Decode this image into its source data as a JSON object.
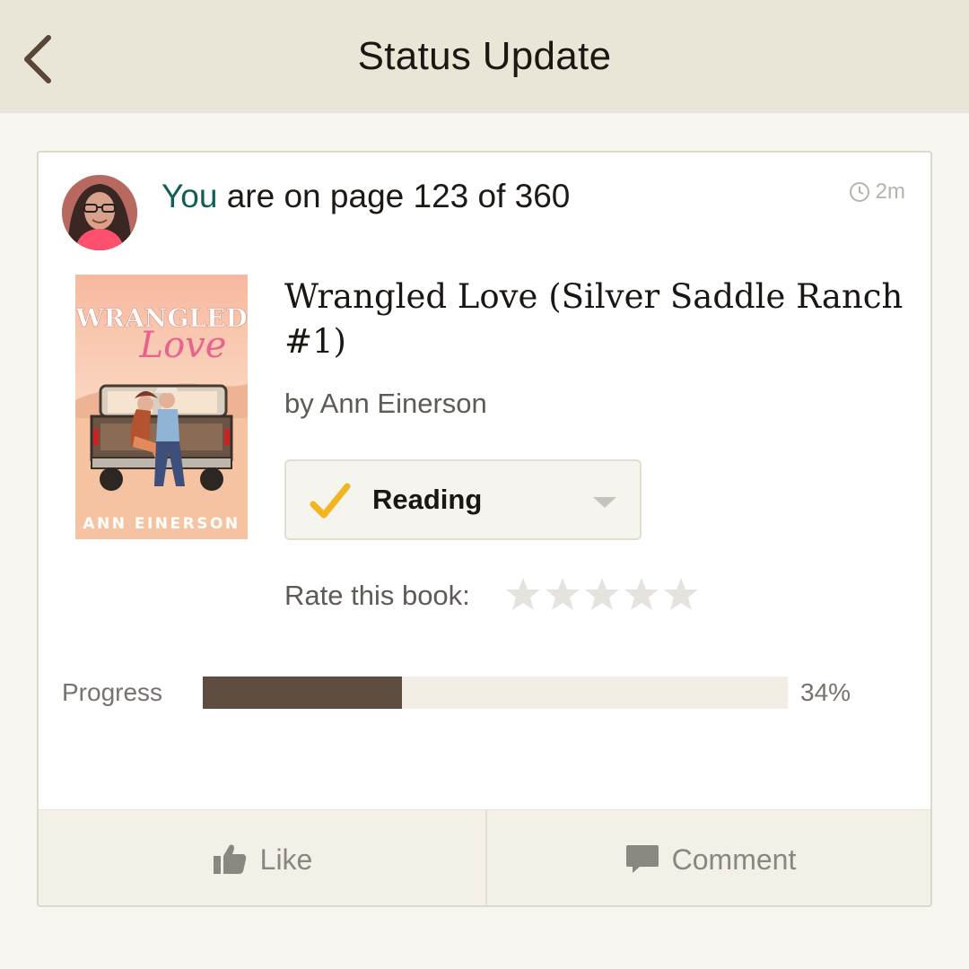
{
  "header": {
    "title": "Status Update",
    "back_icon": "chevron-left-icon"
  },
  "status": {
    "actor": "You",
    "text": " are on page 123 of 360",
    "time_ago": "2m"
  },
  "book": {
    "title": "Wrangled Love (Silver Saddle Ranch #1)",
    "author_line": "by Ann Einerson",
    "cover": {
      "title_line1": "WRANGLED",
      "title_line2": "Love",
      "author": "ANN EINERSON"
    }
  },
  "shelf": {
    "label": "Reading",
    "check_color": "#f2b51f"
  },
  "rating": {
    "label": "Rate this book:",
    "value": 0,
    "max": 5
  },
  "progress": {
    "label": "Progress",
    "percent_text": "34%",
    "fraction": 0.34
  },
  "actions": {
    "like_label": "Like",
    "comment_label": "Comment"
  },
  "colors": {
    "accent_you": "#0f5f55",
    "progress_fill": "#5f4c40",
    "header_bg": "#e9e6d7"
  }
}
